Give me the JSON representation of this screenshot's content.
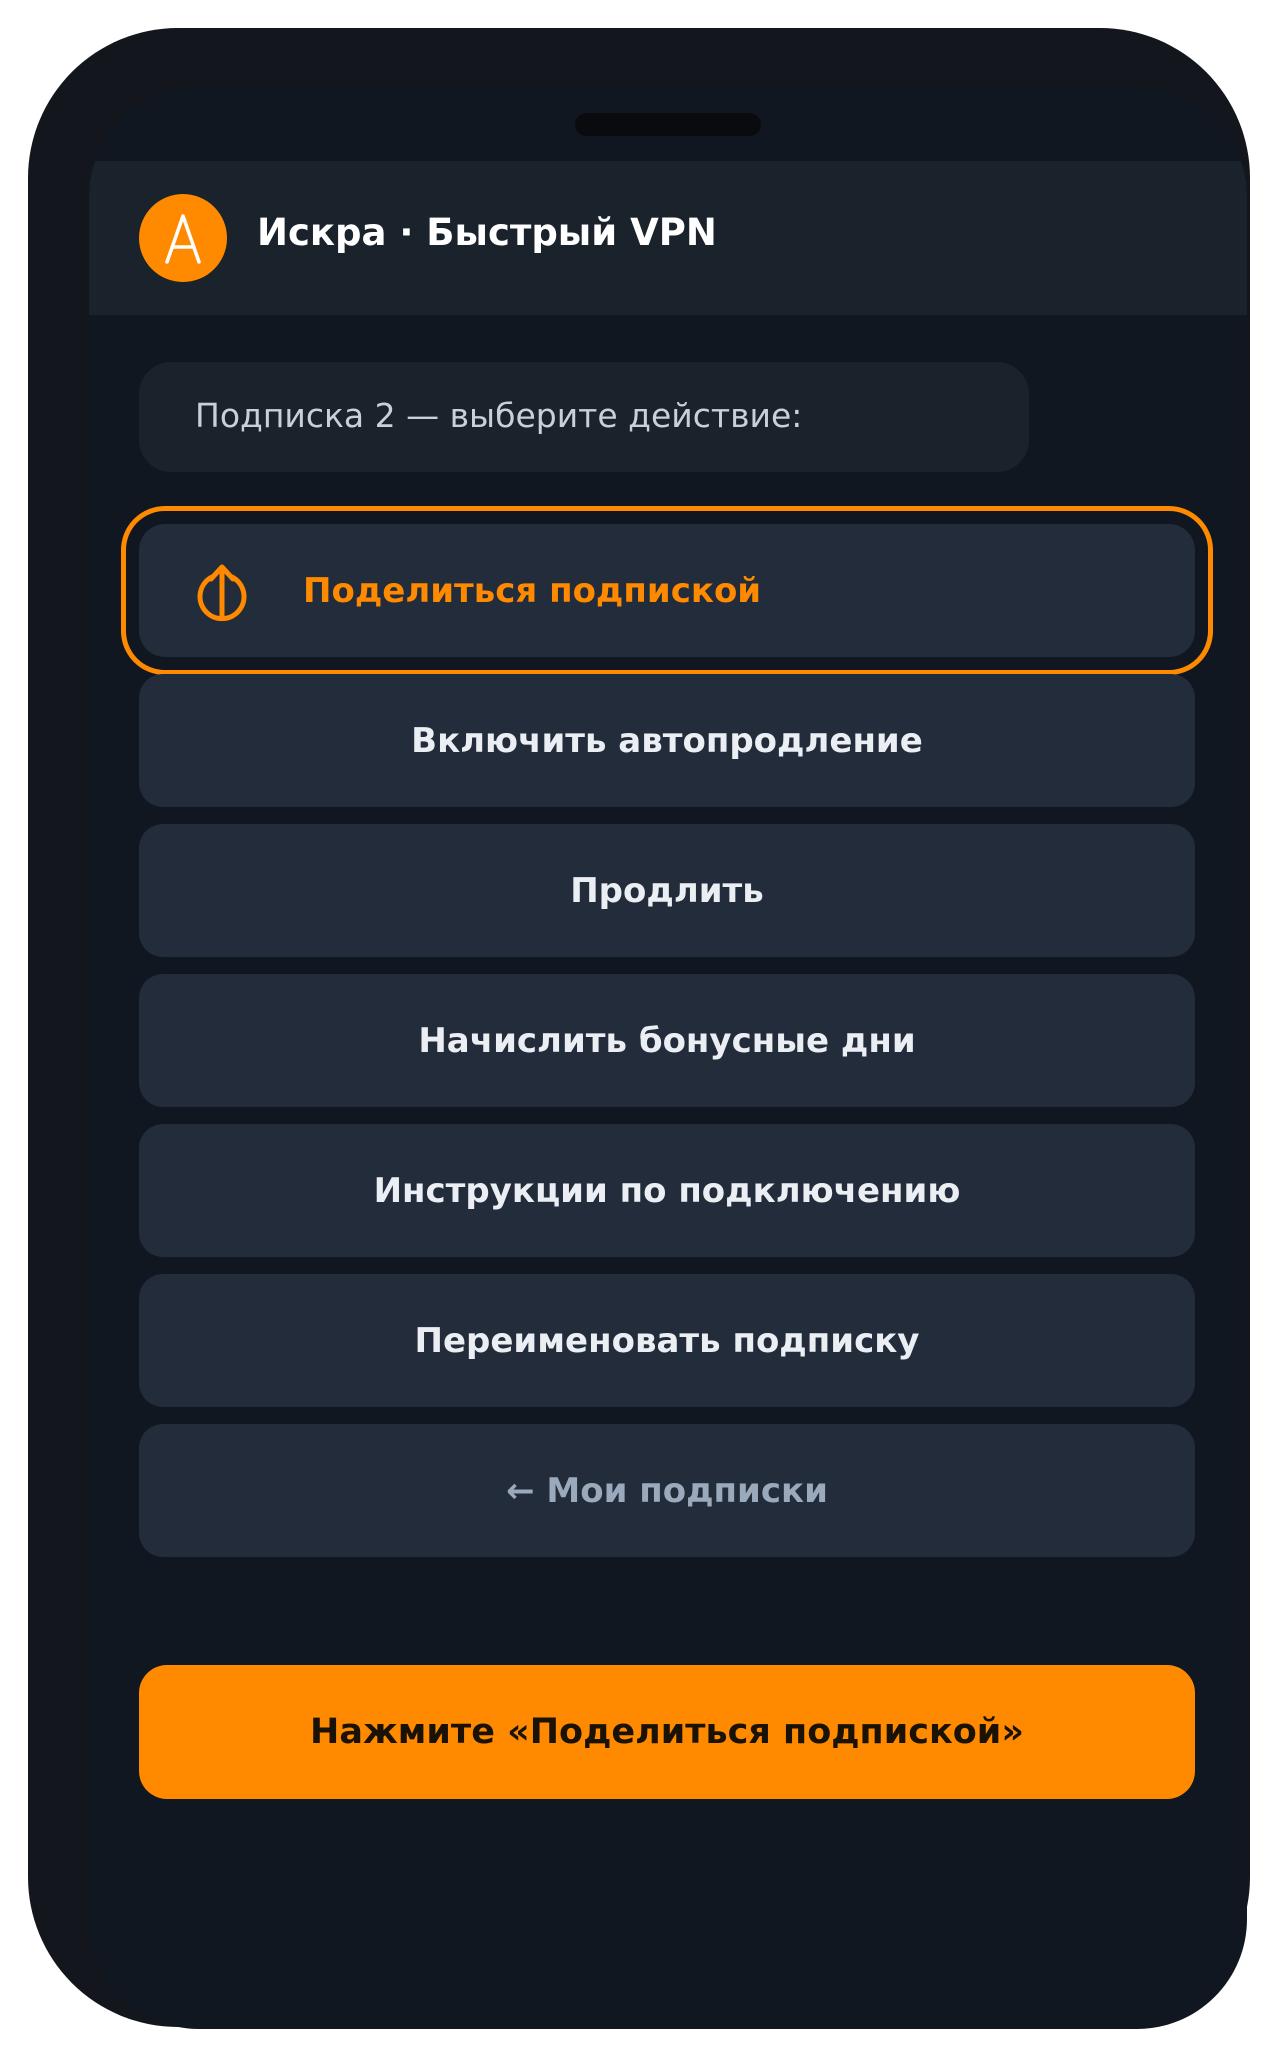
{
  "app": {
    "title": "Искра · Быстрый VPN",
    "avatar_icon": "letter-a-logo-icon",
    "accent_color": "#ff8a00"
  },
  "message": {
    "text": "Подписка 2 — выберите действие:"
  },
  "actions": [
    {
      "label": "Поделиться подпиской",
      "icon": "share-upload-icon",
      "highlighted": true
    },
    {
      "label": "Включить автопродление"
    },
    {
      "label": "Продлить"
    },
    {
      "label": "Начислить бонусные дни"
    },
    {
      "label": "Инструкции по подключению"
    },
    {
      "label": "Переименовать подписку"
    },
    {
      "label": "← Мои подписки"
    }
  ],
  "cta": {
    "label": "Нажмите «Поделиться подпиской»"
  }
}
